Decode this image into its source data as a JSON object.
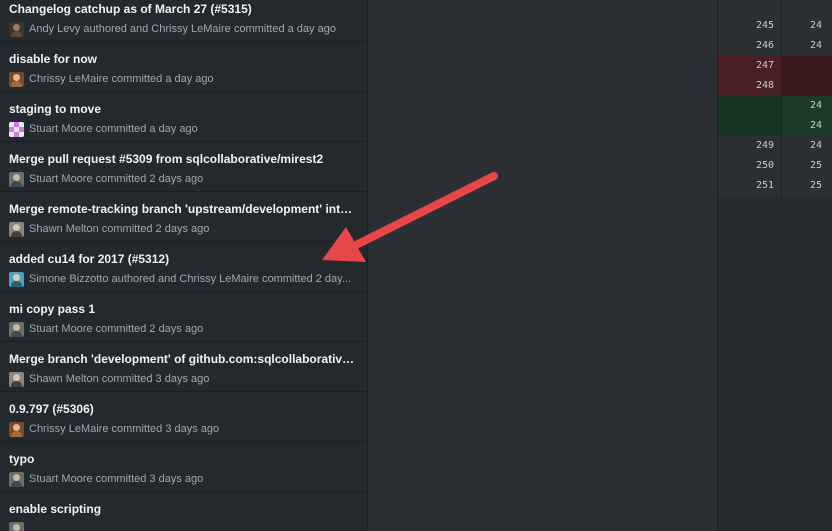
{
  "commits": [
    {
      "title": "Changelog catchup as of March 27 (#5315)",
      "byline": "Andy Levy authored and Chrissy LeMaire committed a day ago",
      "avatar": "avatar-dark"
    },
    {
      "title": "disable for now",
      "byline": "Chrissy LeMaire committed a day ago",
      "avatar": "avatar-chrissy"
    },
    {
      "title": "staging to move",
      "byline": "Stuart Moore committed a day ago",
      "avatar": "avatar-pattern"
    },
    {
      "title": "Merge pull request #5309 from sqlcollaborative/mirest2",
      "byline": "Stuart Moore committed 2 days ago",
      "avatar": "avatar-stuart"
    },
    {
      "title": "Merge remote-tracking branch 'upstream/development' into ...",
      "byline": "Shawn Melton committed 2 days ago",
      "avatar": "avatar-shawn"
    },
    {
      "title": "added cu14 for 2017 (#5312)",
      "byline": "Simone Bizzotto authored and Chrissy LeMaire committed 2 day...",
      "avatar": "avatar-simone"
    },
    {
      "title": "mi copy pass 1",
      "byline": "Stuart Moore committed 2 days ago",
      "avatar": "avatar-stuart"
    },
    {
      "title": "Merge branch 'development' of github.com:sqlcollaborative/...",
      "byline": "Shawn Melton committed 3 days ago",
      "avatar": "avatar-shawn"
    },
    {
      "title": "0.9.797 (#5306)",
      "byline": "Chrissy LeMaire committed 3 days ago",
      "avatar": "avatar-chrissy"
    },
    {
      "title": "typo",
      "byline": "Stuart Moore committed 3 days ago",
      "avatar": "avatar-stuart"
    },
    {
      "title": "enable scripting",
      "byline": "",
      "avatar": "avatar-stuart"
    }
  ],
  "diff_lines": [
    {
      "old": "245",
      "new": "24",
      "type": "context"
    },
    {
      "old": "246",
      "new": "24",
      "type": "context"
    },
    {
      "old": "247",
      "new": "",
      "type": "removed"
    },
    {
      "old": "248",
      "new": "",
      "type": "removed"
    },
    {
      "old": "",
      "new": "24",
      "type": "added"
    },
    {
      "old": "",
      "new": "24",
      "type": "added"
    },
    {
      "old": "249",
      "new": "24",
      "type": "context"
    },
    {
      "old": "250",
      "new": "25",
      "type": "context"
    },
    {
      "old": "251",
      "new": "25",
      "type": "context"
    }
  ],
  "colors": {
    "arrow": "#e8474a",
    "removed_bg": "#3c1a1c",
    "added_bg": "#163221"
  }
}
